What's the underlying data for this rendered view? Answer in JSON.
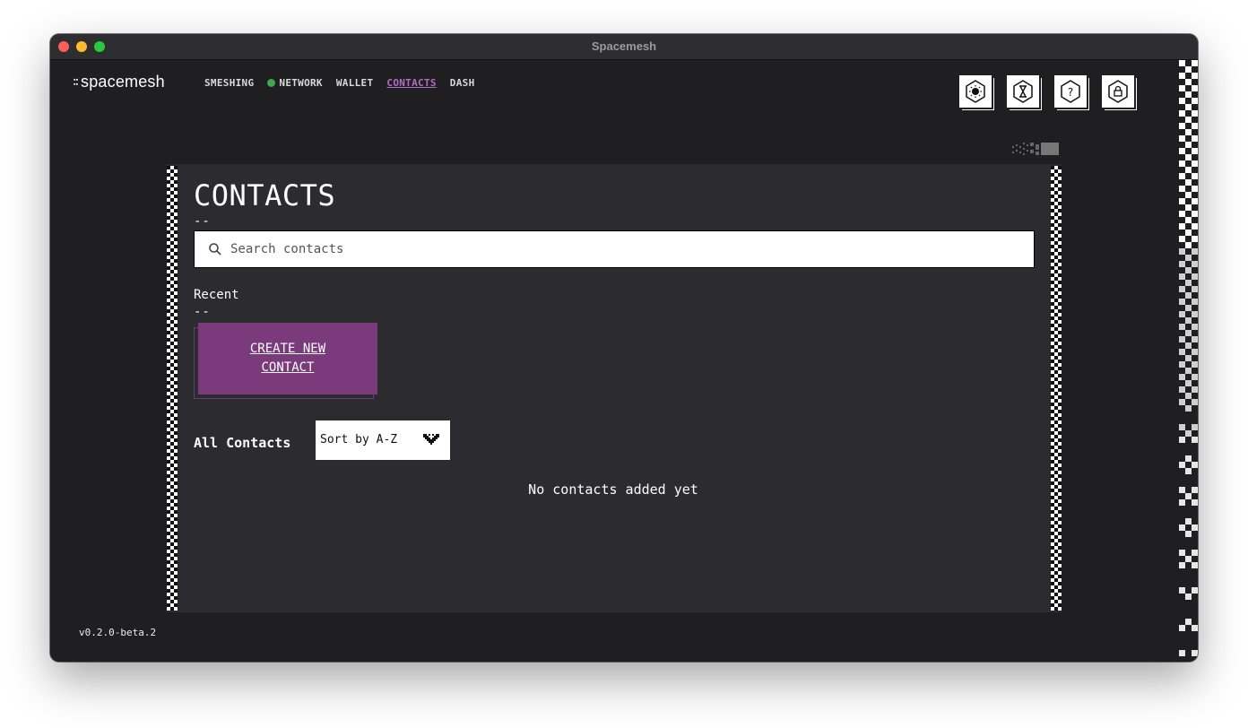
{
  "window": {
    "title": "Spacemesh"
  },
  "logo": {
    "text": "spacemesh"
  },
  "nav": {
    "items": [
      {
        "label": "SMESHING"
      },
      {
        "label": "NETWORK",
        "status_dot_color": "#3fa84b"
      },
      {
        "label": "WALLET"
      },
      {
        "label": "CONTACTS",
        "active": true
      },
      {
        "label": "DASH"
      }
    ]
  },
  "toolbar_icons": [
    "theme-icon",
    "hourglass-icon",
    "help-icon",
    "lock-icon"
  ],
  "page": {
    "title": "CONTACTS",
    "title_dash": "--",
    "search": {
      "placeholder": "Search contacts",
      "value": ""
    },
    "recent": {
      "label": "Recent",
      "dash": "--"
    },
    "create_button": "CREATE NEW CONTACT",
    "all_contacts_label": "All Contacts",
    "sort": {
      "selected": "Sort by A-Z"
    },
    "empty_message": "No contacts added yet"
  },
  "version": "v0.2.0-beta.2",
  "colors": {
    "accent": "#7a3a7b",
    "active_nav": "#b56bc8",
    "background": "#1f1f21",
    "panel": "#2c2c30"
  }
}
